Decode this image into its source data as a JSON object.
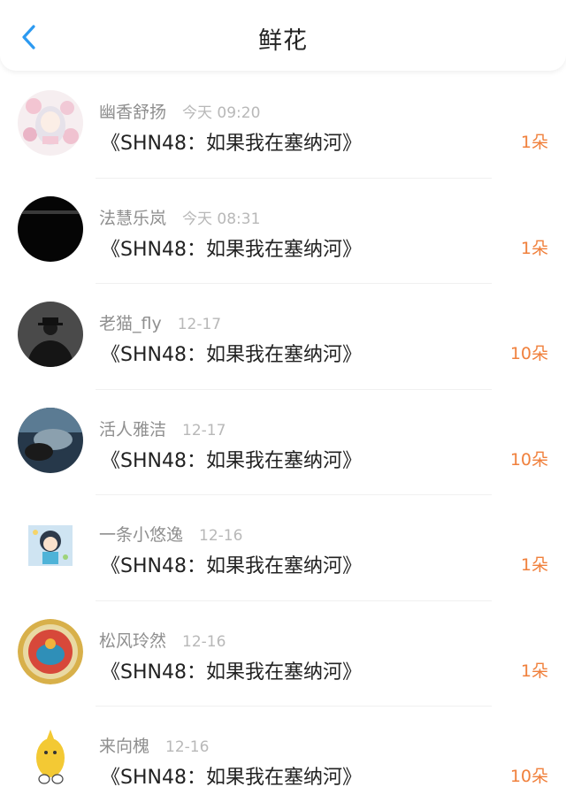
{
  "header": {
    "title": "鲜花",
    "back_icon": "chevron-left-icon"
  },
  "colors": {
    "accent_blue": "#2c9af1",
    "count_orange": "#f0803c",
    "name_gray": "#8f8f8f",
    "time_gray": "#b8b8b8"
  },
  "items": [
    {
      "name": "幽香舒扬",
      "time": "今天 09:20",
      "book": "《SHN48：如果我在塞纳河》",
      "count": "1朵"
    },
    {
      "name": "法慧乐岚",
      "time": "今天 08:31",
      "book": "《SHN48：如果我在塞纳河》",
      "count": "1朵"
    },
    {
      "name": "老猫_fly",
      "time": "12-17",
      "book": "《SHN48：如果我在塞纳河》",
      "count": "10朵"
    },
    {
      "name": "活人雅洁",
      "time": "12-17",
      "book": "《SHN48：如果我在塞纳河》",
      "count": "10朵"
    },
    {
      "name": "一条小悠逸",
      "time": "12-16",
      "book": "《SHN48：如果我在塞纳河》",
      "count": "1朵"
    },
    {
      "name": "松风玲然",
      "time": "12-16",
      "book": "《SHN48：如果我在塞纳河》",
      "count": "1朵"
    },
    {
      "name": "来向槐",
      "time": "12-16",
      "book": "《SHN48：如果我在塞纳河》",
      "count": "10朵"
    }
  ]
}
